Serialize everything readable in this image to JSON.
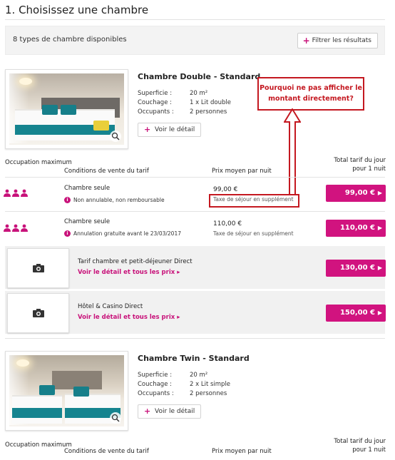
{
  "page": {
    "title": "1. Choisissez une chambre"
  },
  "filter": {
    "count_text": "8 types de chambre disponibles",
    "button_label": "Filtrer les résultats"
  },
  "annotation": {
    "note": "Pourquoi ne pas afficher le montant directement?",
    "color": "#c41820"
  },
  "accent_color": "#d1137f",
  "rooms": [
    {
      "name": "Chambre Double - Standard",
      "specs": [
        {
          "label": "Superficie :",
          "value": "20 m²"
        },
        {
          "label": "Couchage :",
          "value": "1 x Lit double"
        },
        {
          "label": "Occupants :",
          "value": "2 personnes"
        }
      ],
      "detail_label": "Voir le détail"
    },
    {
      "name": "Chambre Twin - Standard",
      "specs": [
        {
          "label": "Superficie :",
          "value": "20 m²"
        },
        {
          "label": "Couchage :",
          "value": "2 x Lit simple"
        },
        {
          "label": "Occupants :",
          "value": "2 personnes"
        }
      ],
      "detail_label": "Voir le détail"
    }
  ],
  "table_headers": {
    "occupation": "Occupation maximum",
    "conditions": "Conditions de vente du tarif",
    "avg_price": "Prix moyen par nuit",
    "total": "Total tarif du jour pour 1 nuit"
  },
  "rates": [
    {
      "title": "Chambre seule",
      "condition": "Non annulable, non remboursable",
      "price": "99,00 €",
      "tax": "Taxe de séjour en supplément",
      "total": "99,00 €"
    },
    {
      "title": "Chambre seule",
      "condition": "Annulation gratuite avant le 23/03/2017",
      "price": "110,00 €",
      "tax": "Taxe de séjour en supplément",
      "total": "110,00 €"
    }
  ],
  "packages": [
    {
      "name": "Tarif chambre et petit-déjeuner Direct",
      "link": "Voir le détail et tous les prix",
      "total": "130,00 €"
    },
    {
      "name": "Hôtel & Casino Direct",
      "link": "Voir le détail et tous les prix",
      "total": "150,00 €"
    }
  ]
}
